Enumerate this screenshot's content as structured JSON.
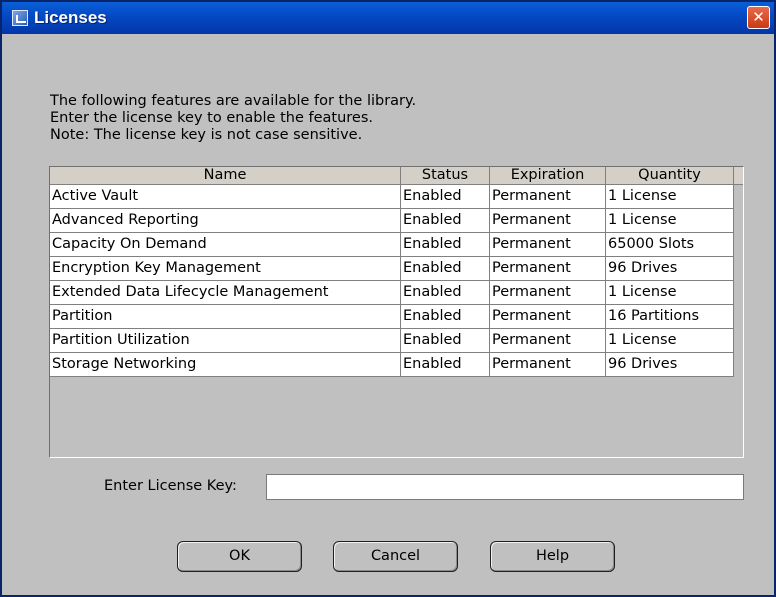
{
  "window": {
    "title": "Licenses",
    "close_glyph": "✕"
  },
  "intro": {
    "line1": "The following features are available for the library.",
    "line2": "Enter the license key to enable the features.",
    "line3": "Note: The license key is not case sensitive."
  },
  "table": {
    "columns": [
      "Name",
      "Status",
      "Expiration",
      "Quantity"
    ],
    "rows": [
      [
        "Active Vault",
        "Enabled",
        "Permanent",
        "1 License"
      ],
      [
        "Advanced Reporting",
        "Enabled",
        "Permanent",
        "1 License"
      ],
      [
        "Capacity On Demand",
        "Enabled",
        "Permanent",
        "65000 Slots"
      ],
      [
        "Encryption Key Management",
        "Enabled",
        "Permanent",
        "96 Drives"
      ],
      [
        "Extended Data Lifecycle Management",
        "Enabled",
        "Permanent",
        "1 License"
      ],
      [
        "Partition",
        "Enabled",
        "Permanent",
        "16 Partitions"
      ],
      [
        "Partition Utilization",
        "Enabled",
        "Permanent",
        "1 License"
      ],
      [
        "Storage Networking",
        "Enabled",
        "Permanent",
        "96 Drives"
      ]
    ]
  },
  "license_key": {
    "label": "Enter License Key:",
    "value": "",
    "placeholder": ""
  },
  "buttons": {
    "ok": "OK",
    "cancel": "Cancel",
    "help": "Help"
  },
  "icons": {
    "app": "app-window-icon",
    "close": "close-icon"
  },
  "colors": {
    "titlebar": "#0548c4",
    "close_button": "#d24a24",
    "dialog_background": "#c0c0c0"
  }
}
